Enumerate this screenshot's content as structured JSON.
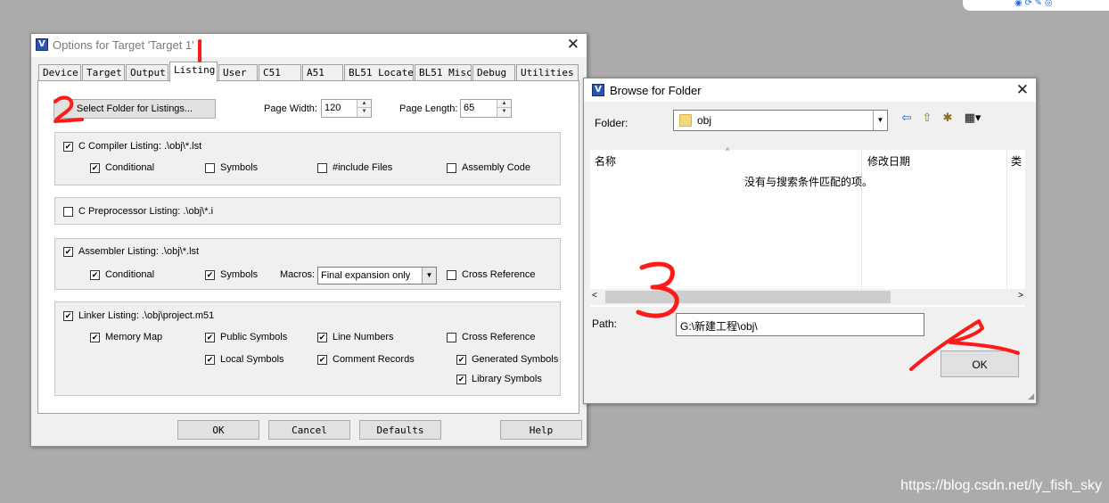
{
  "colors": {
    "annotation": "#ff1a1a",
    "selection": "#0078d7",
    "folder": "#f5d97a"
  },
  "options_dialog": {
    "title": "Options for Target 'Target 1'",
    "tabs": [
      "Device",
      "Target",
      "Output",
      "Listing",
      "User",
      "C51",
      "A51",
      "BL51 Locate",
      "BL51 Misc",
      "Debug",
      "Utilities"
    ],
    "active_tab": "Listing",
    "select_folder_button": "Select Folder for Listings...",
    "page_width_label": "Page Width:",
    "page_width_value": "120",
    "page_length_label": "Page Length:",
    "page_length_value": "65",
    "c_compiler": {
      "label": "C Compiler Listing:  .\\obj\\*.lst",
      "conditional": "Conditional",
      "symbols": "Symbols",
      "include_files": "#include Files",
      "assembly_code": "Assembly Code"
    },
    "c_preprocessor": {
      "label": "C Preprocessor Listing:  .\\obj\\*.i"
    },
    "assembler": {
      "label": "Assembler Listing:  .\\obj\\*.lst",
      "conditional": "Conditional",
      "symbols": "Symbols",
      "macros_label": "Macros:",
      "macros_value": "Final expansion only",
      "cross_reference": "Cross Reference"
    },
    "linker": {
      "label": "Linker Listing:  .\\obj\\project.m51",
      "memory_map": "Memory Map",
      "public_symbols": "Public Symbols",
      "line_numbers": "Line Numbers",
      "cross_reference": "Cross Reference",
      "local_symbols": "Local Symbols",
      "comment_records": "Comment Records",
      "generated_symbols": "Generated Symbols",
      "library_symbols": "Library Symbols"
    },
    "buttons": {
      "ok": "OK",
      "cancel": "Cancel",
      "defaults": "Defaults",
      "help": "Help"
    }
  },
  "browse_dialog": {
    "title": "Browse for Folder",
    "folder_label": "Folder:",
    "folder_value": "obj",
    "columns": [
      "名称",
      "修改日期",
      "类"
    ],
    "empty_message": "没有与搜索条件匹配的项。",
    "path_label": "Path:",
    "path_value": "G:\\新建工程\\obj\\",
    "ok_button": "OK"
  },
  "annotations": [
    "1",
    "2",
    "3"
  ],
  "watermark": "https://blog.csdn.net/ly_fish_sky"
}
